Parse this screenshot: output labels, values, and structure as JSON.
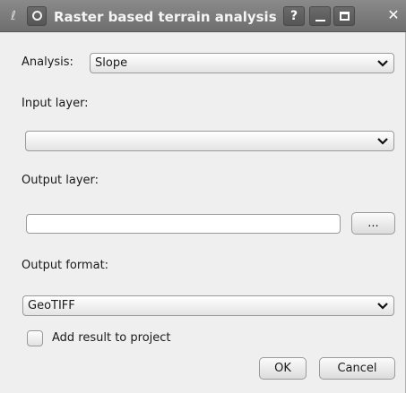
{
  "window": {
    "title": "Raster based terrain analysis",
    "help_label": "?",
    "close_label": "✕"
  },
  "form": {
    "analysis_label": "Analysis:",
    "analysis_value": "Slope",
    "input_layer_label": "Input layer:",
    "input_layer_value": "",
    "output_layer_label": "Output layer:",
    "output_layer_value": "",
    "browse_label": "...",
    "output_format_label": "Output format:",
    "output_format_value": "GeoTIFF",
    "add_result_label": "Add result to project",
    "add_result_checked": false
  },
  "buttons": {
    "ok": "OK",
    "cancel": "Cancel"
  }
}
